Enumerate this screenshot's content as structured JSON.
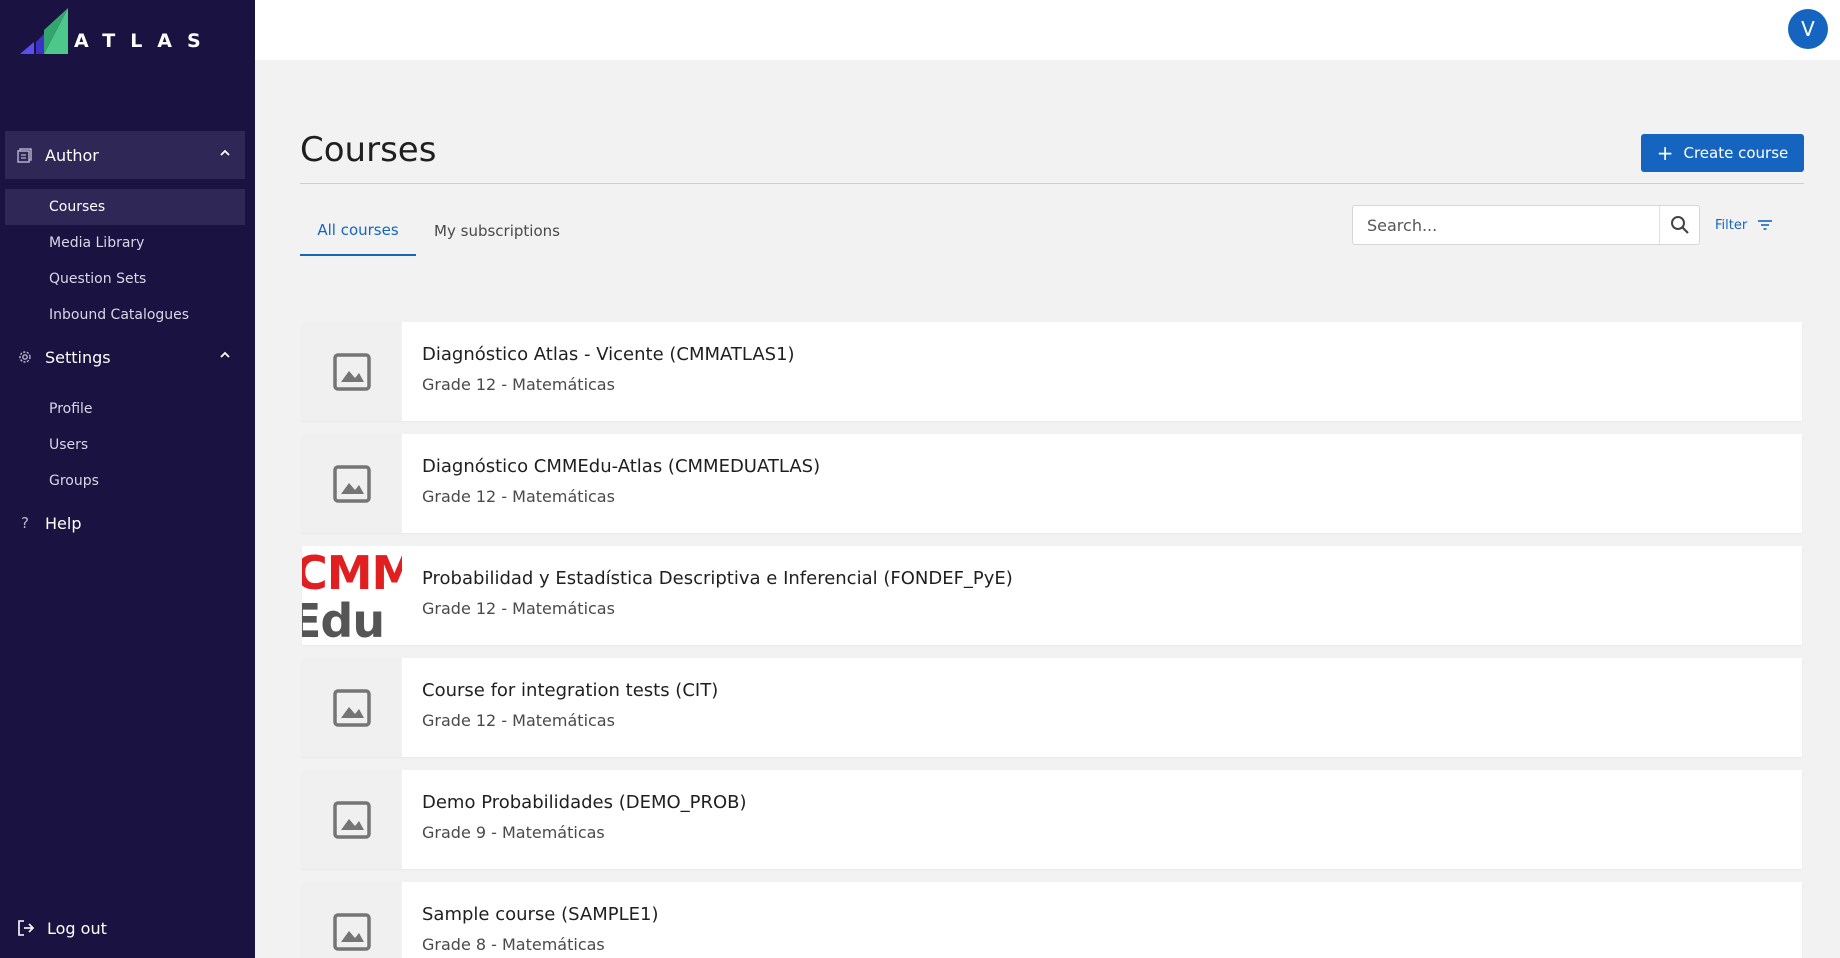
{
  "brand": {
    "name": "ATLAS",
    "accent": "#1565c0",
    "sidebar_bg": "#1a1240"
  },
  "sidebar": {
    "author": {
      "label": "Author",
      "icon": "book-icon",
      "expanded": true
    },
    "author_items": [
      {
        "label": "Courses",
        "active": true
      },
      {
        "label": "Media Library",
        "active": false
      },
      {
        "label": "Question Sets",
        "active": false
      },
      {
        "label": "Inbound Catalogues",
        "active": false
      }
    ],
    "settings": {
      "label": "Settings",
      "icon": "gear-icon",
      "expanded": true
    },
    "settings_items": [
      {
        "label": "Profile"
      },
      {
        "label": "Users"
      },
      {
        "label": "Groups"
      }
    ],
    "help": {
      "label": "Help",
      "icon": "question-icon"
    },
    "logout": {
      "label": "Log out",
      "icon": "logout-icon"
    }
  },
  "topbar": {
    "avatar_letter": "V"
  },
  "main": {
    "title": "Courses",
    "create_label": "Create course",
    "tabs": [
      {
        "label": "All courses",
        "active": true
      },
      {
        "label": "My subscriptions",
        "active": false
      }
    ],
    "search": {
      "placeholder": "Search...",
      "value": ""
    },
    "filter_label": "Filter",
    "courses": [
      {
        "title": "Diagnóstico Atlas - Vicente (CMMATLAS1)",
        "subtitle": "Grade 12 - Matemáticas",
        "thumbnail": "image-placeholder-icon"
      },
      {
        "title": "Diagnóstico CMMEdu-Atlas (CMMEDUATLAS)",
        "subtitle": "Grade 12 - Matemáticas",
        "thumbnail": "image-placeholder-icon"
      },
      {
        "title": "Probabilidad y Estadística Descriptiva e Inferencial (FONDEF_PyE)",
        "subtitle": "Grade 12 - Matemáticas",
        "thumbnail": "cmmedu-logo",
        "logo_line1": "CMM",
        "logo_line2": "Edu"
      },
      {
        "title": "Course for integration tests (CIT)",
        "subtitle": "Grade 12 - Matemáticas",
        "thumbnail": "image-placeholder-icon"
      },
      {
        "title": "Demo Probabilidades (DEMO_PROB)",
        "subtitle": "Grade 9 - Matemáticas",
        "thumbnail": "image-placeholder-icon"
      },
      {
        "title": "Sample course (SAMPLE1)",
        "subtitle": "Grade 8 - Matemáticas",
        "thumbnail": "image-placeholder-icon"
      }
    ]
  }
}
